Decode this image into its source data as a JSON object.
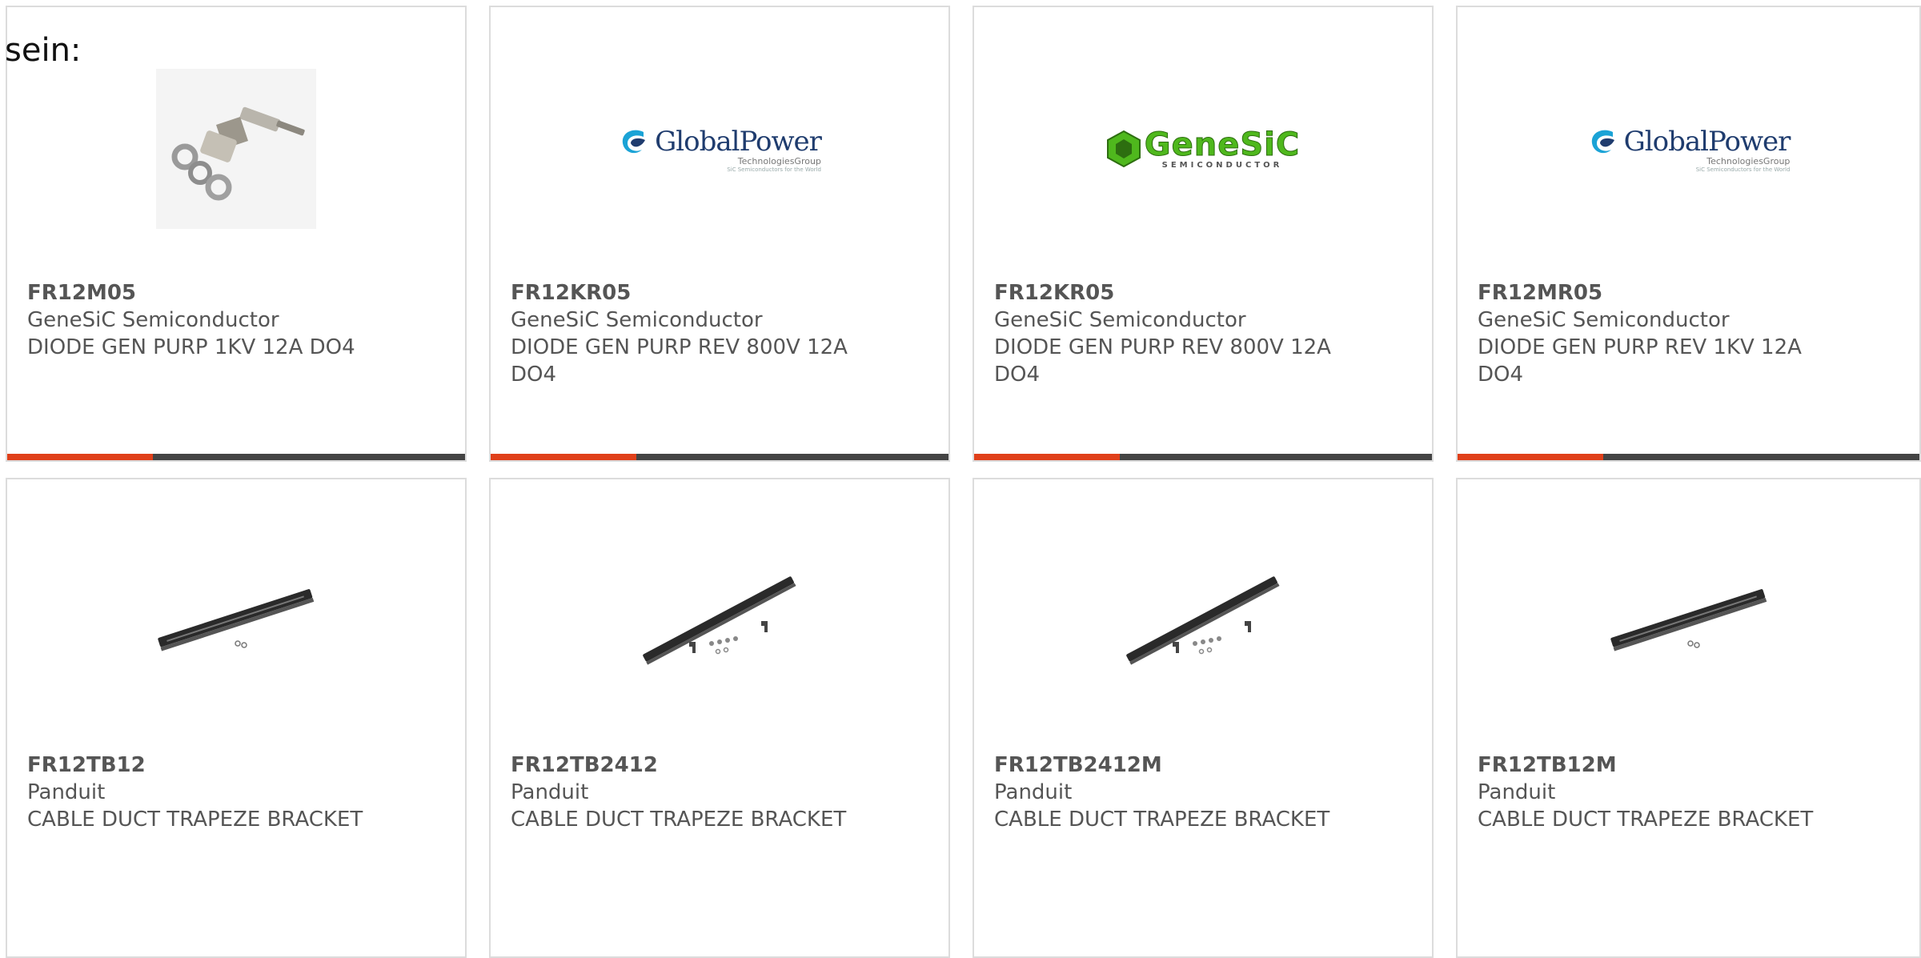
{
  "page": {
    "label": "sein:",
    "accent_color": "#e0401a",
    "bar_color": "#444444"
  },
  "products": [
    {
      "part_number": "FR12M05",
      "manufacturer": "GeneSiC Semiconductor",
      "description": "DIODE GEN PURP 1KV 12A DO4",
      "image": "stud-diode-photo",
      "bar": true
    },
    {
      "part_number": "FR12KR05",
      "manufacturer": "GeneSiC Semiconductor",
      "description": "DIODE GEN PURP REV 800V 12A DO4",
      "image": "globalpower-logo",
      "logo_text": "GlobalPower",
      "logo_sub": "TechnologiesGroup",
      "logo_tag": "SiC Semiconductors for the World",
      "bar": true
    },
    {
      "part_number": "FR12KR05",
      "manufacturer": "GeneSiC Semiconductor",
      "description": "DIODE GEN PURP REV 800V 12A DO4",
      "image": "genesic-logo",
      "logo_text": "GeneSiC",
      "logo_sub": "SEMICONDUCTOR",
      "bar": true
    },
    {
      "part_number": "FR12MR05",
      "manufacturer": "GeneSiC Semiconductor",
      "description": "DIODE GEN PURP REV 1KV 12A DO4",
      "image": "globalpower-logo",
      "logo_text": "GlobalPower",
      "logo_sub": "TechnologiesGroup",
      "logo_tag": "SiC Semiconductors for the World",
      "bar": true
    },
    {
      "part_number": "FR12TB12",
      "manufacturer": "Panduit",
      "description": "CABLE DUCT TRAPEZE BRACKET",
      "image": "bracket-short-photo",
      "bar": false
    },
    {
      "part_number": "FR12TB2412",
      "manufacturer": "Panduit",
      "description": "CABLE DUCT TRAPEZE BRACKET",
      "image": "bracket-long-photo",
      "bar": false
    },
    {
      "part_number": "FR12TB2412M",
      "manufacturer": "Panduit",
      "description": "CABLE DUCT TRAPEZE BRACKET",
      "image": "bracket-long-photo",
      "bar": false
    },
    {
      "part_number": "FR12TB12M",
      "manufacturer": "Panduit",
      "description": "CABLE DUCT TRAPEZE BRACKET",
      "image": "bracket-short-photo",
      "bar": false
    }
  ]
}
